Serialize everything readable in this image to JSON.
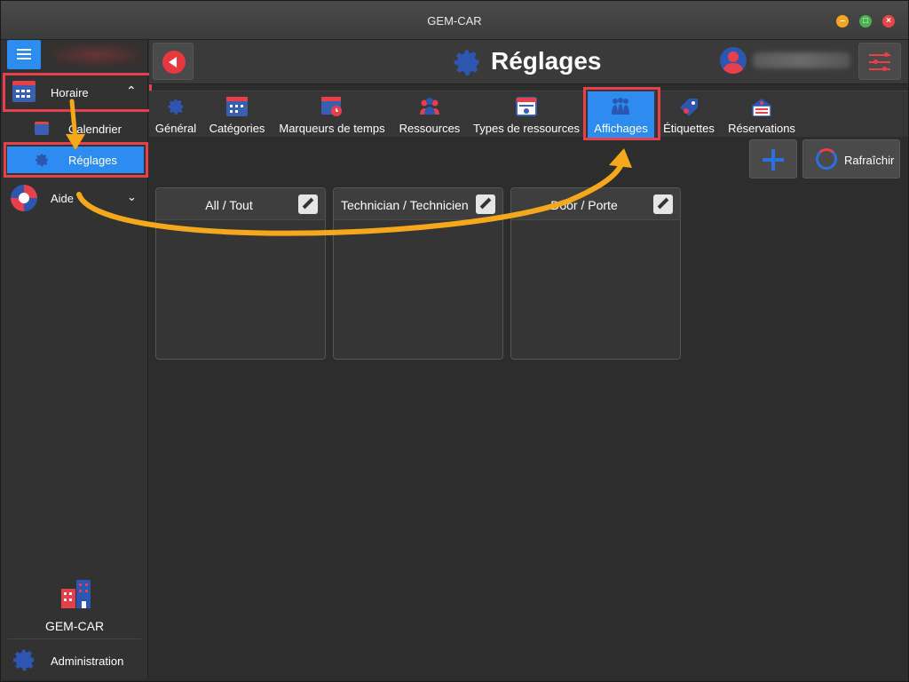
{
  "window": {
    "title": "GEM-CAR"
  },
  "sidebar": {
    "items": [
      {
        "label": "Horaire"
      },
      {
        "label": "Calendrier"
      },
      {
        "label": "Réglages"
      },
      {
        "label": "Aide"
      }
    ],
    "brand_label": "GEM-CAR",
    "admin_label": "Administration"
  },
  "header": {
    "title": "Réglages"
  },
  "tabs": [
    {
      "label": "Général"
    },
    {
      "label": "Catégories"
    },
    {
      "label": "Marqueurs de temps"
    },
    {
      "label": "Ressources"
    },
    {
      "label": "Types de ressources"
    },
    {
      "label": "Affichages"
    },
    {
      "label": "Étiquettes"
    },
    {
      "label": "Réservations"
    }
  ],
  "toolbar": {
    "refresh_label": "Rafraîchir"
  },
  "cards": [
    {
      "title": "All / Tout"
    },
    {
      "title": "Technician / Technicien"
    },
    {
      "title": "Door / Porte"
    }
  ],
  "colors": {
    "accent": "#2d8cf0",
    "highlight": "#e8404a",
    "annotation_arrow": "#f5a81c"
  }
}
